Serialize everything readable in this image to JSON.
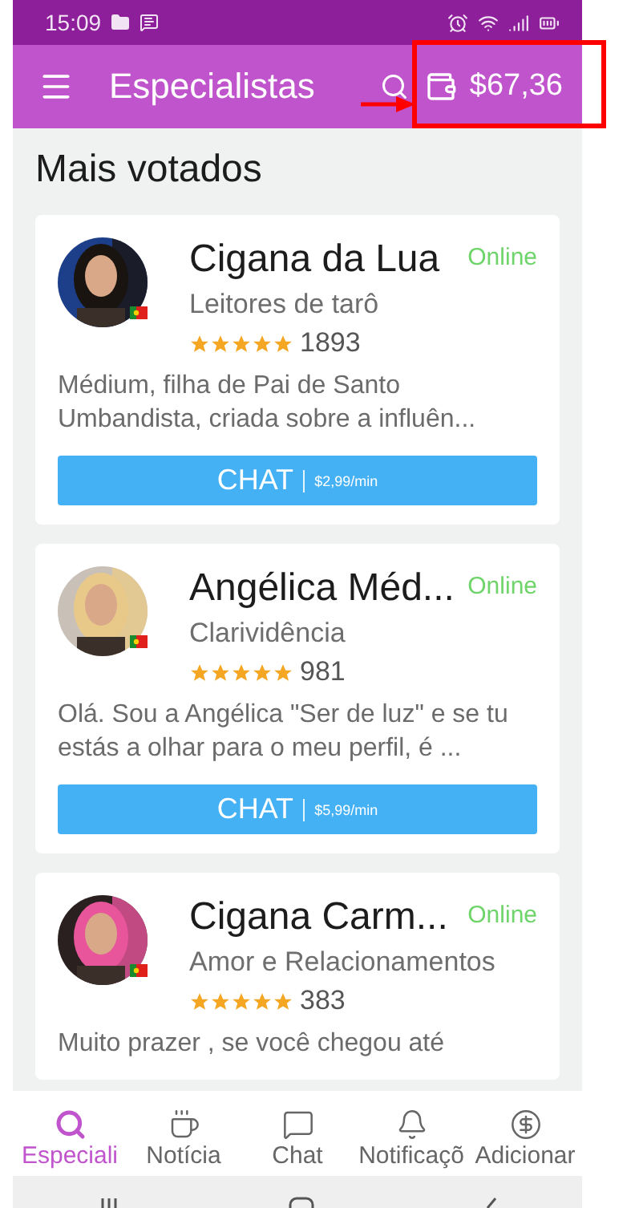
{
  "status_bar": {
    "time": "15:09"
  },
  "app_bar": {
    "title": "Especialistas",
    "balance": "$67,36"
  },
  "section": {
    "title": "Mais votados"
  },
  "experts": [
    {
      "name": "Cigana da Lua",
      "status": "Online",
      "category": "Leitores de tarô",
      "stars": 5,
      "reviews": "1893",
      "description": "Médium, filha de Pai de Santo Umbandista, criada sobre a influên...",
      "button": "CHAT",
      "price": "$2,99/min"
    },
    {
      "name": "Angélica Méd...",
      "status": "Online",
      "category": "Clarividência",
      "stars": 5,
      "reviews": "981",
      "description": "Olá. Sou a Angélica \"Ser de luz\" e se tu estás a olhar para o meu perfil, é ...",
      "button": "CHAT",
      "price": "$5,99/min"
    },
    {
      "name": "Cigana Carm...",
      "status": "Online",
      "category": "Amor e Relacionamentos",
      "stars": 5,
      "reviews": "383",
      "description": "Muito prazer , se você chegou até"
    }
  ],
  "bottom_nav": [
    {
      "label": "Especiali",
      "selected": true
    },
    {
      "label": "Notícia",
      "selected": false
    },
    {
      "label": "Chat",
      "selected": false
    },
    {
      "label": "Notificaçõ",
      "selected": false
    },
    {
      "label": "Adicionar",
      "selected": false
    }
  ]
}
